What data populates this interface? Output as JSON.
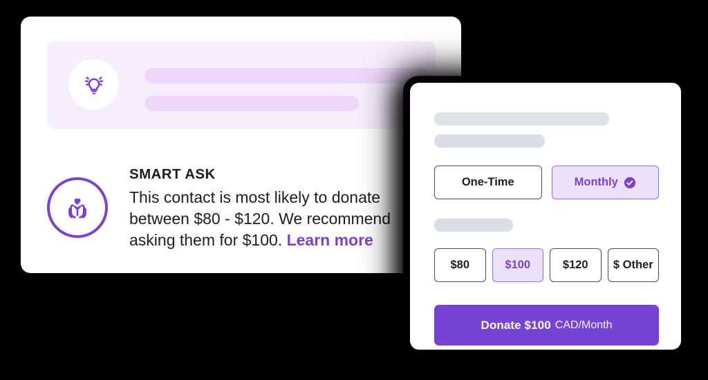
{
  "insight_card": {
    "banner": {
      "icon": "lightbulb-icon",
      "placeholder_bars": [
        "",
        ""
      ]
    },
    "eyebrow": "SMART ASK",
    "icon": "hands-heart-icon",
    "body_text": "This contact is most likely to donate between $80 - $120. We recommend asking them for $100. ",
    "link_label": "Learn more"
  },
  "donation_card": {
    "placeholder_bars": [
      "",
      "",
      ""
    ],
    "frequency_options": [
      {
        "label": "One-Time",
        "selected": false
      },
      {
        "label": "Monthly",
        "selected": true
      }
    ],
    "amount_options": [
      {
        "label": "$80",
        "selected": false
      },
      {
        "label": "$100",
        "selected": true
      },
      {
        "label": "$120",
        "selected": false
      },
      {
        "label": "$ Other",
        "selected": false
      }
    ],
    "submit": {
      "primary_label": "Donate $100",
      "secondary_label": "CAD/Month"
    }
  },
  "colors": {
    "accent_purple": "#7c3fd8",
    "button_purple": "#7643d4",
    "selected_fill": "#ece1fb",
    "banner_bg": "#f6eefd",
    "banner_bar": "#eed6fb",
    "skeleton_grey": "#dfe1e7"
  }
}
